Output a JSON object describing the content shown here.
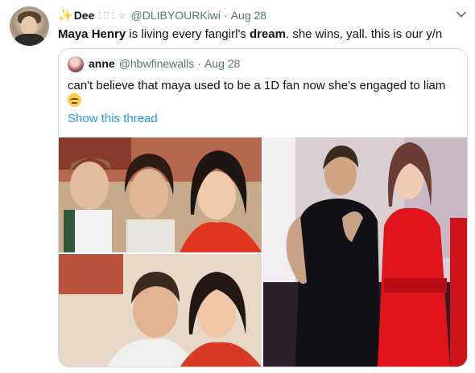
{
  "tweet": {
    "author_name": "Dee",
    "name_prefix_emoji": "✨",
    "name_suffix_glyphs": "⸬⸬ ☆",
    "handle": "@DLIBYOURKiwi",
    "separator": "·",
    "date": "Aug 28",
    "text_part1": "Maya Henry",
    "text_part2": " is living every fangirl's ",
    "text_part3": "dream",
    "text_part4": ". she wins, yall. this is our y/n"
  },
  "quoted": {
    "author_name": "anne",
    "handle": "@hbwfinewalls",
    "separator": "·",
    "date": "Aug 28",
    "text": "can't believe that maya used to be a 1D fan now she's engaged to liam",
    "show_thread": "Show this thread"
  },
  "icons": {
    "menu": "chevron-down-icon",
    "emoji": "relieved-face-emoji"
  },
  "colors": {
    "link": "#1d9bf0",
    "muted": "#5b7083",
    "border": "#cfd9de"
  }
}
